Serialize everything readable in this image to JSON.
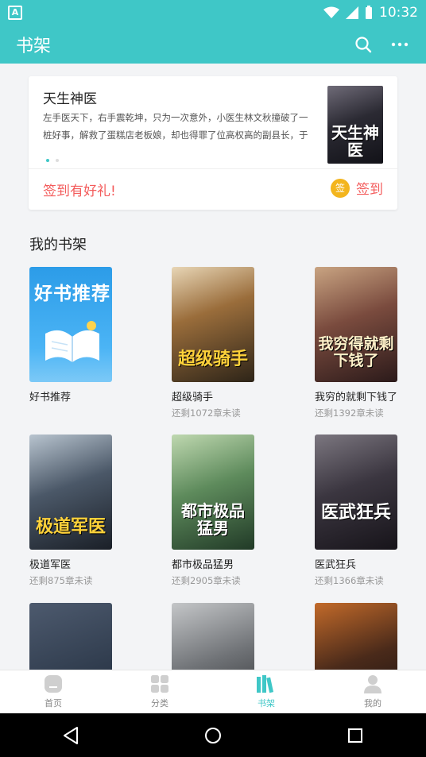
{
  "status": {
    "time": "10:32",
    "app_badge": "A"
  },
  "appbar": {
    "title": "书架"
  },
  "banner": {
    "title": "天生神医",
    "description": "左手医天下，右手震乾坤，只为一次意外，小医生林文秋撞破了一桩好事，解救了蛋糕店老板娘，却也得罪了位高权高的副县长，于是林...",
    "cover_text": "天生神医",
    "promo": "签到有好礼!",
    "sign_badge": "签",
    "sign_label": "签到"
  },
  "shelf": {
    "title": "我的书架",
    "books": [
      {
        "title": "好书推荐",
        "progress": "",
        "cover_text": "好书推荐"
      },
      {
        "title": "超级骑手",
        "progress": "还剩1072章未读",
        "cover_text": "超级骑手"
      },
      {
        "title": "我穷的就剩下钱了",
        "progress": "还剩1392章未读",
        "cover_text": "我穷得就剩下钱了"
      },
      {
        "title": "极道军医",
        "progress": "还剩875章未读",
        "cover_text": "极道军医"
      },
      {
        "title": "都市极品猛男",
        "progress": "还剩2905章未读",
        "cover_text": "都市极品猛男"
      },
      {
        "title": "医武狂兵",
        "progress": "还剩1366章未读",
        "cover_text": "医武狂兵"
      },
      {
        "title": "",
        "progress": "",
        "cover_text": ""
      },
      {
        "title": "",
        "progress": "",
        "cover_text": ""
      },
      {
        "title": "",
        "progress": "",
        "cover_text": ""
      }
    ]
  },
  "tabs": [
    {
      "label": "首页",
      "icon": "home-icon"
    },
    {
      "label": "分类",
      "icon": "category-icon"
    },
    {
      "label": "书架",
      "icon": "bookshelf-icon",
      "active": true
    },
    {
      "label": "我的",
      "icon": "profile-icon"
    }
  ],
  "colors": {
    "primary": "#3fc7c7",
    "accent_red": "#f35b5b",
    "badge_yellow": "#f3b51e"
  }
}
